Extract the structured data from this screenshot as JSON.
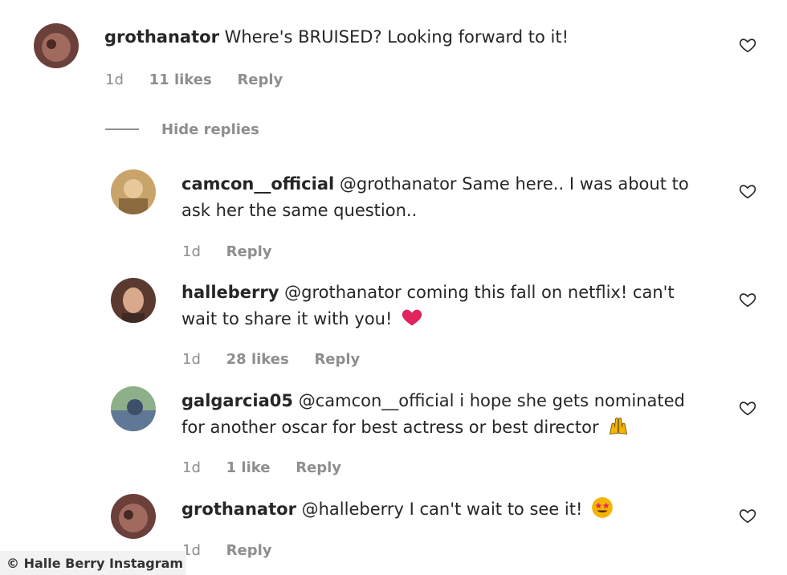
{
  "comments": [
    {
      "username": "grothanator",
      "text": "Where's BRUISED? Looking forward to it!",
      "time": "1d",
      "likes": "11 likes",
      "reply": "Reply"
    },
    {
      "username": "camcon__official",
      "text": "@grothanator Same here.. I was about to ask her the same question..",
      "time": "1d",
      "likes": "",
      "reply": "Reply"
    },
    {
      "username": "halleberry",
      "text": "@grothanator coming this fall on netflix! can't wait to share it with you!",
      "time": "1d",
      "likes": "28 likes",
      "reply": "Reply"
    },
    {
      "username": "galgarcia05",
      "text": "@camcon__official i hope she gets nominated for another oscar for best actress or best director",
      "time": "1d",
      "likes": "1 like",
      "reply": "Reply"
    },
    {
      "username": "grothanator",
      "text": "@halleberry I can't wait to see it!",
      "time": "1d",
      "likes": "",
      "reply": "Reply"
    }
  ],
  "hide_replies": "Hide replies",
  "credit": "© Halle Berry Instagram",
  "icons": {
    "like": "heart-outline-icon",
    "emoji_heart": "red-heart-emoji",
    "emoji_hands": "raised-hands-emoji",
    "emoji_star_eyes": "star-struck-emoji"
  },
  "colors": {
    "text": "#262626",
    "meta": "#8e8e8e",
    "heart_emoji": "#e0245e"
  }
}
